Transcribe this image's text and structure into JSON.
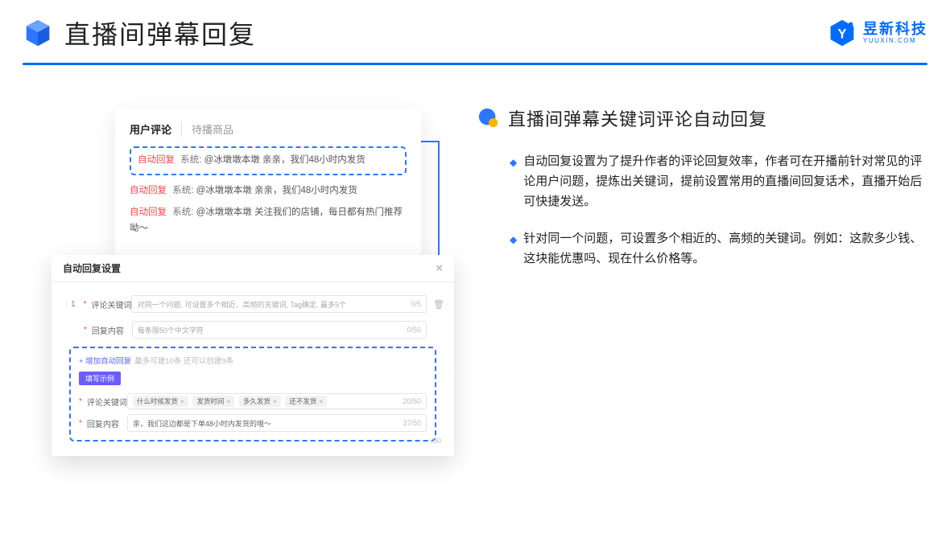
{
  "header": {
    "title": "直播间弹幕回复",
    "logo_text": "昱新科技",
    "logo_url": "YUUXIN.COM"
  },
  "comments": {
    "tab_active": "用户评论",
    "tab_inactive": "待播商品",
    "auto_tag": "自动回复",
    "sys_label": "系统:",
    "row1": "@冰墩墩本墩 亲亲，我们48小时内发货",
    "row2": "@冰墩墩本墩 亲亲，我们48小时内发货",
    "row3": "@冰墩墩本墩 关注我们的店铺，每日都有热门推荐呦～"
  },
  "settings": {
    "title": "自动回复设置",
    "idx": "1",
    "label_keyword": "评论关键词",
    "placeholder_keyword": "对同一个问题, 可设置多个相近、高频的关键词, Tag确定, 最多5个",
    "count_keyword": "0/5",
    "label_content": "回复内容",
    "placeholder_content": "每条限50个中文字符",
    "count_content": "0/50",
    "add_link": "+ 增加自动回复",
    "add_link_sub": "最多可建10条 还可以创建9条",
    "pill": "填写示例",
    "example": {
      "label_keyword": "评论关键词",
      "tags": [
        "什么时候发货",
        "发货时间",
        "多久发货",
        "还不发货"
      ],
      "count_kw": "20/50",
      "label_content": "回复内容",
      "content": "亲，我们这边都是下单48小时内发货的哦～",
      "count_ct": "37/50"
    },
    "extra_count": "/50"
  },
  "right": {
    "section_title": "直播间弹幕关键词评论自动回复",
    "p1": "自动回复设置为了提升作者的评论回复效率，作者可在开播前针对常见的评论用户问题，提炼出关键词，提前设置常用的直播间回复话术，直播开始后可快捷发送。",
    "p2": "针对同一个问题，可设置多个相近的、高频的关键词。例如：这款多少钱、这块能优惠吗、现在什么价格等。"
  }
}
